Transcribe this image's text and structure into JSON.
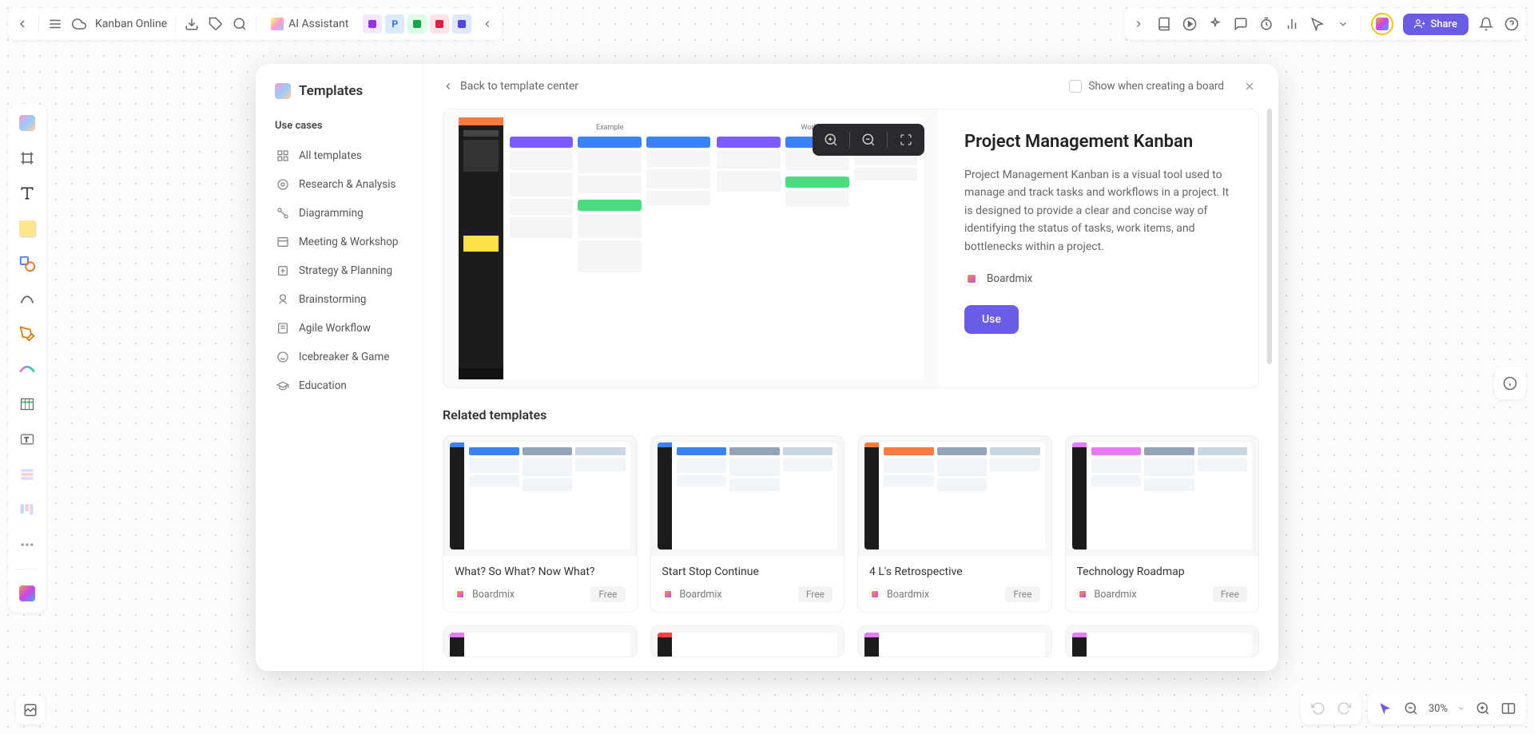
{
  "topbar": {
    "file_name": "Kanban Online",
    "ai_label": "AI Assistant",
    "share_label": "Share",
    "tab_chips": [
      {
        "bg": "#f3e8ff",
        "fg": "#9333ea"
      },
      {
        "bg": "#dbeafe",
        "fg": "#2563eb",
        "text": "P"
      },
      {
        "bg": "#dcfce7",
        "fg": "#16a34a"
      },
      {
        "bg": "#ffe4e6",
        "fg": "#e11d48"
      },
      {
        "bg": "#e0e7ff",
        "fg": "#4f46e5"
      }
    ]
  },
  "modal": {
    "sidebar_title": "Templates",
    "use_cases_label": "Use cases",
    "categories": [
      "All templates",
      "Research & Analysis",
      "Diagramming",
      "Meeting & Workshop",
      "Strategy & Planning",
      "Brainstorming",
      "Agile Workflow",
      "Icebreaker & Game",
      "Education"
    ],
    "back_label": "Back to template center",
    "checkbox_label": "Show when creating a board",
    "hero": {
      "title": "Project Management Kanban",
      "description": "Project Management Kanban is a visual tool used to manage and track tasks and workflows in a project. It is designed to provide a clear and concise way of identifying the status of tasks, work items, and bottlenecks within a project.",
      "author": "Boardmix",
      "use_label": "Use",
      "preview_sections": [
        "Example",
        "Work here"
      ]
    },
    "related_title": "Related templates",
    "related": [
      {
        "name": "What? So What? Now What?",
        "author": "Boardmix",
        "badge": "Free",
        "accent": "#3b82f6"
      },
      {
        "name": "Start Stop Continue",
        "author": "Boardmix",
        "badge": "Free",
        "accent": "#3b82f6"
      },
      {
        "name": "4 L's Retrospective",
        "author": "Boardmix",
        "badge": "Free",
        "accent": "#ff7a3c"
      },
      {
        "name": "Technology Roadmap",
        "author": "Boardmix",
        "badge": "Free",
        "accent": "#e879f9"
      }
    ]
  },
  "bottom": {
    "zoom": "30%"
  }
}
